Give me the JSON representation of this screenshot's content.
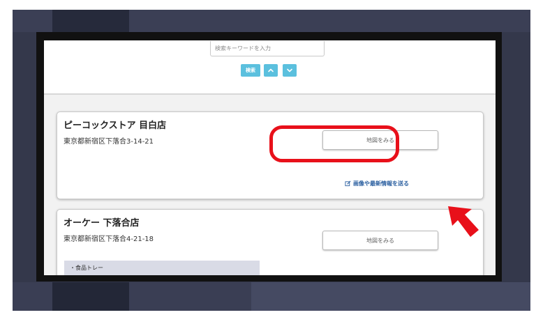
{
  "search": {
    "placeholder": "検索キーワードを入力",
    "button_label": "検索",
    "up_icon": "chevron-up-icon",
    "down_icon": "chevron-down-icon"
  },
  "stores": [
    {
      "name": "ピーコックストア 目白店",
      "address": "東京都新宿区下落合3-14-21",
      "map_button": "地図をみる",
      "send_info": "画像や最新情報を送る"
    },
    {
      "name": "オーケー 下落合店",
      "address": "東京都新宿区下落合4-21-18",
      "map_button": "地図をみる",
      "items": [
        "・食品トレー"
      ]
    }
  ],
  "colors": {
    "accent_button": "#5bc0de",
    "link": "#2a5fa0",
    "highlight": "#e8101a",
    "frame": "#34384b"
  },
  "annotation": {
    "arrow_icon": "red-arrow-icon"
  }
}
